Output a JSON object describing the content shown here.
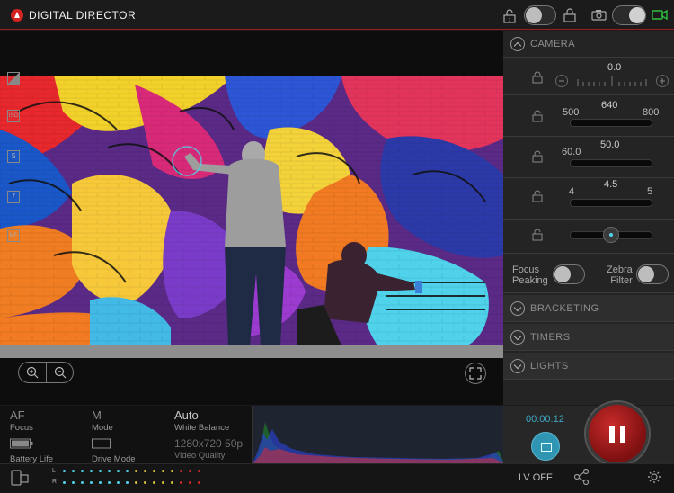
{
  "app": {
    "title": "DIGITAL DIRECTOR"
  },
  "camera": {
    "section_label": "CAMERA",
    "exposure": {
      "value": "0.0"
    },
    "iso": {
      "icon_label": "ISO",
      "min": "500",
      "value": "640",
      "max": "800",
      "level": 0.5
    },
    "shutter": {
      "icon_label": "S",
      "min": "60.0",
      "value": "50.0"
    },
    "aperture": {
      "icon_label": "f",
      "min": "4",
      "value": "4.5",
      "max": "5"
    },
    "focus": {
      "icon_label": "MF",
      "level": 0.5
    },
    "focus_peaking_label": "Focus\nPeaking",
    "zebra_filter_label": "Zebra\nFilter"
  },
  "sections": {
    "bracketing": "BRACKETING",
    "timers": "TIMERS",
    "lights": "LIGHTS"
  },
  "info": {
    "focus_value": "AF",
    "focus_label": "Focus",
    "mode_value": "M",
    "mode_label": "Mode",
    "wb_value": "Auto",
    "wb_label": "White Balance",
    "battery_label": "Battery Life",
    "drive_label": "Drive Mode",
    "quality_value": "1280x720 50p",
    "quality_label": "Video Quality"
  },
  "recording": {
    "timer": "00:00:12"
  },
  "footer": {
    "lv_off": "LV OFF",
    "meter_left": "L",
    "meter_right": "R"
  },
  "colors": {
    "accent": "#2f95b3",
    "record": "#c82a2a",
    "brand": "#d32323",
    "camera_toggle_on": "#2fbf3f"
  }
}
